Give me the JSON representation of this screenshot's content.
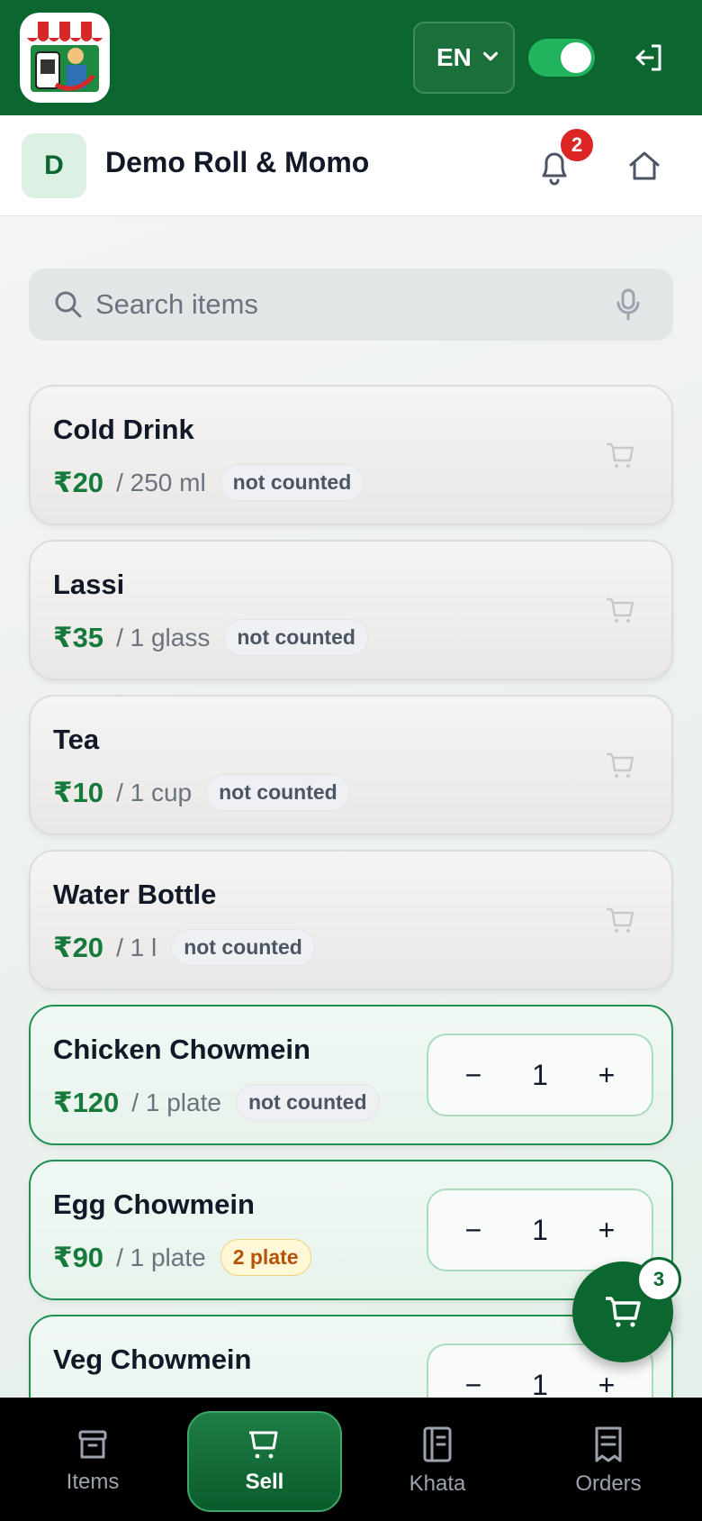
{
  "header": {
    "language": "EN",
    "online_toggle": true
  },
  "shop": {
    "avatar_letter": "D",
    "name": "Demo Roll & Momo",
    "notification_count": "2"
  },
  "search": {
    "placeholder": "Search items"
  },
  "items": [
    {
      "name": "Cold Drink",
      "price": "₹20",
      "unit": "/ 250 ml",
      "stock": "not counted",
      "qty": null
    },
    {
      "name": "Lassi",
      "price": "₹35",
      "unit": "/ 1 glass",
      "stock": "not counted",
      "qty": null
    },
    {
      "name": "Tea",
      "price": "₹10",
      "unit": "/ 1 cup",
      "stock": "not counted",
      "qty": null
    },
    {
      "name": "Water Bottle",
      "price": "₹20",
      "unit": "/ 1 l",
      "stock": "not counted",
      "qty": null
    },
    {
      "name": "Chicken Chowmein",
      "price": "₹120",
      "unit": "/ 1 plate",
      "stock": "not counted",
      "qty": "1"
    },
    {
      "name": "Egg Chowmein",
      "price": "₹90",
      "unit": "/ 1 plate",
      "stock": "2 plate",
      "qty": "1"
    },
    {
      "name": "Veg Chowmein",
      "price": "",
      "unit": "",
      "stock": "",
      "qty": "1"
    }
  ],
  "stepper": {
    "minus": "−",
    "plus": "+"
  },
  "cart": {
    "count": "3"
  },
  "nav": [
    {
      "label": "Items",
      "icon": "box-icon"
    },
    {
      "label": "Sell",
      "icon": "cart-icon"
    },
    {
      "label": "Khata",
      "icon": "ledger-icon"
    },
    {
      "label": "Orders",
      "icon": "receipt-icon"
    }
  ],
  "colors": {
    "brand": "#0b6630",
    "accent": "#22b35e",
    "badge": "#dc2626",
    "price": "#157a3b"
  }
}
